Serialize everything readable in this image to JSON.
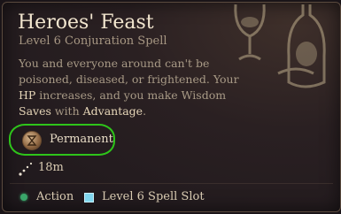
{
  "spell": {
    "title": "Heroes' Feast",
    "subtitle": "Level 6 Conjuration Spell",
    "description": {
      "line1": "You and everyone around can't be",
      "line2": "poisoned, diseased, or frightened. Your",
      "hp": "HP",
      "line3_rest": " increases, and you make Wisdom",
      "saves": "Saves",
      "with": " with ",
      "advantage": "Advantage",
      "period": "."
    },
    "duration": "Permanent",
    "range": "18m",
    "costs": {
      "action": "Action",
      "slot": "Level 6 Spell Slot"
    }
  },
  "colors": {
    "highlight_ring": "#2ec41a",
    "action_dot": "#3aa66a",
    "spell_slot": "#7fd6ee"
  },
  "icons": {
    "duration": "hourglass-coin-icon",
    "range": "range-dots-icon",
    "background": "feast-goblet-bottle-art"
  }
}
